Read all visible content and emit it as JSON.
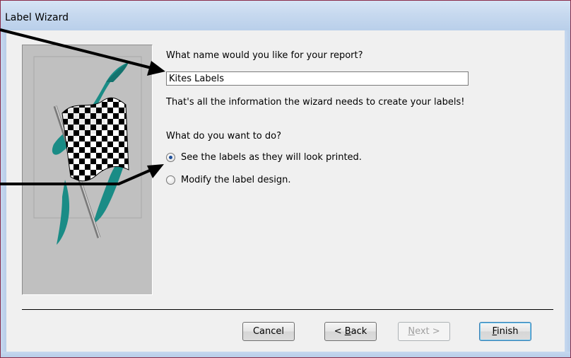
{
  "window": {
    "title": "Label Wizard"
  },
  "main": {
    "name_prompt": "What name would you like for your report?",
    "report_name": "Kites Labels",
    "info_text": "That's all the information the wizard needs to create your labels!",
    "action_prompt": "What do you want to do?",
    "options": [
      {
        "label": "See the labels as they will look printed.",
        "selected": true
      },
      {
        "label": "Modify the label design.",
        "selected": false
      }
    ]
  },
  "buttons": {
    "cancel": "Cancel",
    "back_prefix": "< ",
    "back_key": "B",
    "back_rest": "ack",
    "next_key": "N",
    "next_rest": "ext >",
    "finish_key": "F",
    "finish_rest": "inish"
  },
  "colors": {
    "accent_teal": "#1a8c86",
    "annotation_arrow": "#000000",
    "frame_border": "#8a2c4a"
  },
  "icons": {
    "side_art": "checkered-flag-icon"
  }
}
